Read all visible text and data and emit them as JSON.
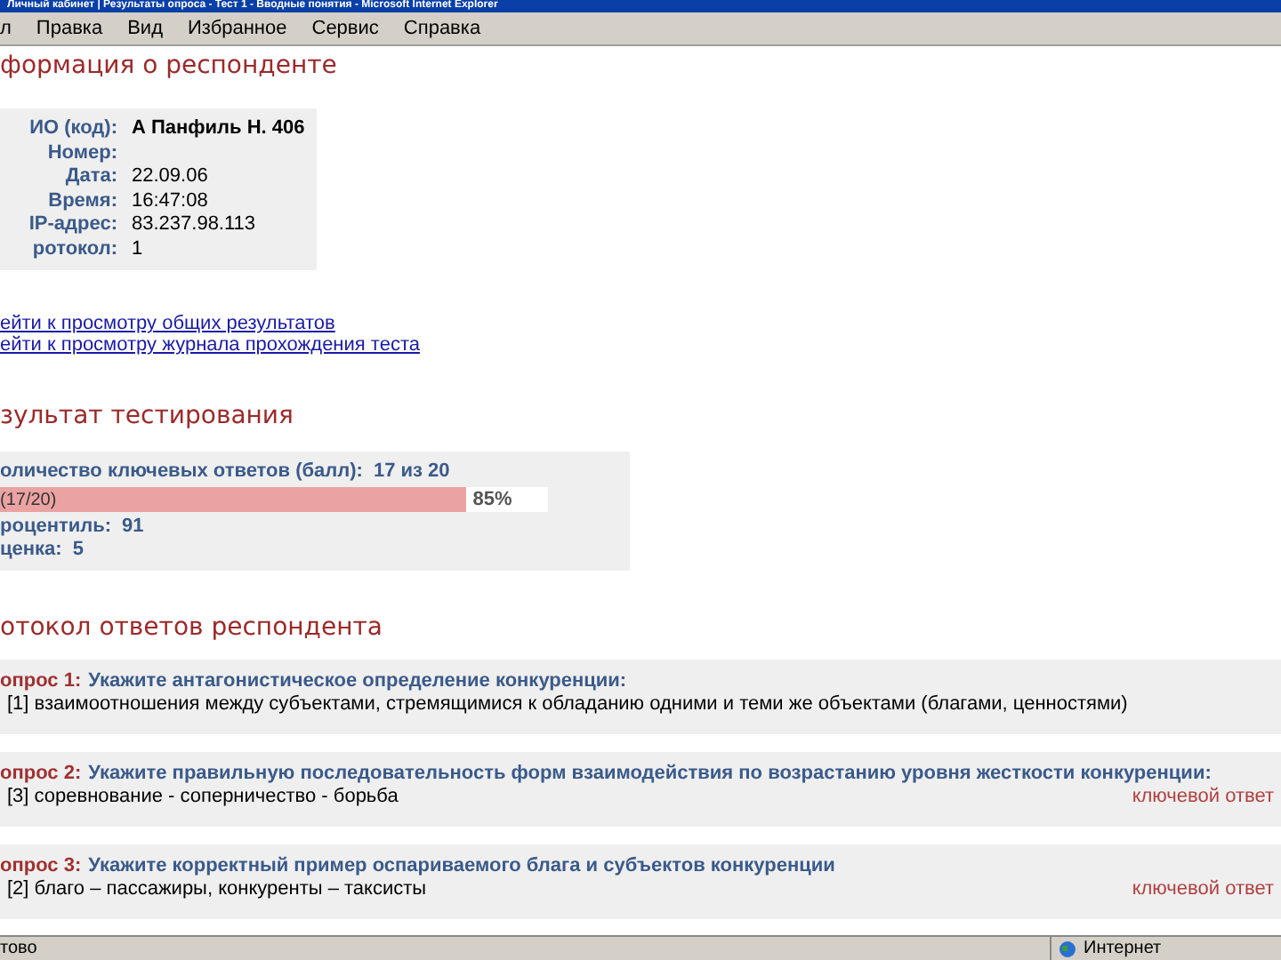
{
  "window": {
    "title": "Личный кабинет | Результаты опроса - Тест 1 - Вводные понятия - Microsoft Internet Explorer"
  },
  "menu": [
    "л",
    "Правка",
    "Вид",
    "Избранное",
    "Сервис",
    "Справка"
  ],
  "respondent": {
    "heading": "формация о респонденте",
    "fields": [
      {
        "label": "ИО (код):",
        "value": "А Панфиль Н. 406",
        "emphasis": true
      },
      {
        "label": "Номер:"
      },
      {
        "label": "Дата:",
        "value": "22.09.06"
      },
      {
        "label": "Время:",
        "value": "16:47:08"
      },
      {
        "label": "IP-адрес:",
        "value": "83.237.98.113"
      },
      {
        "label": "ротокол:",
        "value": "1"
      }
    ]
  },
  "links": [
    "ейти к просмотру общих результатов",
    "ейти к просмотру журнала прохождения теста"
  ],
  "result": {
    "heading": "зультат тестирования",
    "key_answers_label": "оличество ключевых ответов (балл):",
    "key_answers_value": "17 из 20",
    "bar_label": "(17/20)",
    "level": 0.85,
    "percent": "85%",
    "percentile_label": "роцентиль:",
    "percentile_value": "91",
    "grade_label": "ценка:",
    "grade_value": "5"
  },
  "protocol": {
    "heading": "отокол ответов респондента",
    "questions": [
      {
        "number": "опрос 1:",
        "text": "Укажите антагонистическое определение конкуренции:",
        "answer": "[1] взаимоотношения между субъектами, стремящимися к обладанию одними и теми же объектами (благами, ценностями)"
      },
      {
        "number": "опрос 2:",
        "text": "Укажите правильную последовательность форм взаимодействия по возрастанию уровня жесткости конкуренции:",
        "answer": "[3] соревнование - соперничество - борьба",
        "note": "ключевой ответ"
      },
      {
        "number": "опрос 3:",
        "text": "Укажите корректный пример оспариваемого блага и субъектов конкуренции",
        "answer": "[2] благо – пассажиры, конкуренты – таксисты",
        "note": "ключевой ответ"
      }
    ]
  },
  "status_bar": {
    "text": "тово",
    "zone": "Интернет"
  }
}
